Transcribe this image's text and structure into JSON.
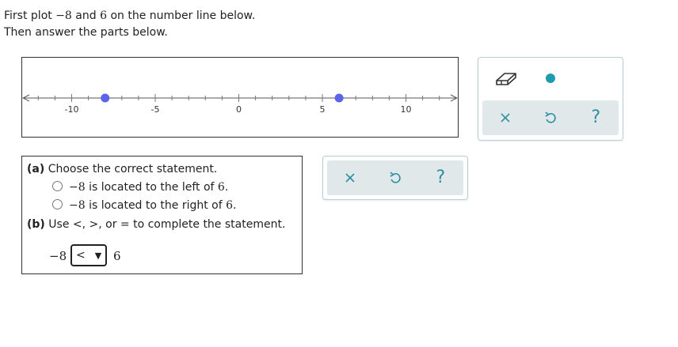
{
  "instructions": {
    "line1_pre": "First plot ",
    "line1_num1": "−8",
    "line1_mid": " and ",
    "line1_num2": "6",
    "line1_post": " on the number line below.",
    "line2": "Then answer the parts below."
  },
  "number_line": {
    "min": -12,
    "max": 12,
    "tick_step": 1,
    "labeled_ticks": [
      {
        "value": -10,
        "label": "-10"
      },
      {
        "value": -5,
        "label": "-5"
      },
      {
        "value": 0,
        "label": "0"
      },
      {
        "value": 5,
        "label": "5"
      },
      {
        "value": 10,
        "label": "10"
      }
    ],
    "plotted_points": [
      -8,
      6
    ],
    "point_color": "#5b63e6"
  },
  "top_toolbar": {
    "tools": [
      "eraser-icon",
      "point-tool-icon"
    ],
    "point_tool_color": "#1f9bae",
    "actions": [
      "close-icon",
      "undo-icon",
      "help-icon"
    ],
    "help_label": "?"
  },
  "question": {
    "part_a_label": "(a)",
    "part_a_text": " Choose the correct statement.",
    "options": [
      {
        "num": "−8",
        "rest": " is located to the left of ",
        "num2": "6",
        "end": "."
      },
      {
        "num": "−8",
        "rest": " is located to the right of ",
        "num2": "6",
        "end": "."
      }
    ],
    "part_b_label": "(b)",
    "part_b_text": " Use <, >, or = to complete the statement.",
    "compare_left": "−8",
    "compare_selected": "<",
    "compare_right": "6"
  },
  "answer_toolbar": {
    "actions": [
      "close-icon",
      "undo-icon",
      "help-icon"
    ],
    "help_label": "?"
  },
  "colors": {
    "accent": "#2e8fa3",
    "toolbar_bg": "#e1e8ea",
    "panel_border": "#b8cfd6"
  }
}
